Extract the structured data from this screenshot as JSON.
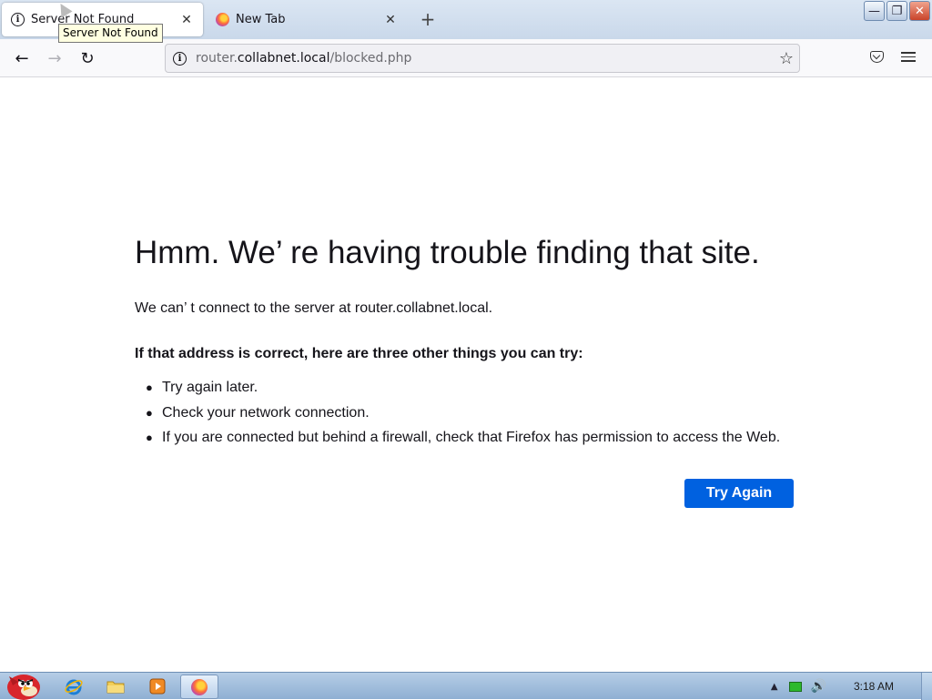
{
  "tabs": [
    {
      "label": "Server Not Found",
      "icon": "info-icon",
      "active": true
    },
    {
      "label": "New Tab",
      "icon": "firefox-icon",
      "active": false
    }
  ],
  "tooltip": "Server Not Found",
  "url": {
    "prefix": "router.",
    "host": "collabnet.local",
    "path": "/blocked.php"
  },
  "error": {
    "title": "Hmm. We’ re having trouble finding that site.",
    "description": "We can’ t connect to the server at router.collabnet.local.",
    "tips_heading": "If that address is correct, here are three other things you can try:",
    "tips": [
      "Try again later.",
      "Check your network connection.",
      "If you are connected but behind a firewall, check that Firefox has permission to access the Web."
    ],
    "button_label": "Try Again"
  },
  "taskbar": {
    "clock": "3:18 AM",
    "pinned": [
      "internet-explorer-icon",
      "folder-icon",
      "media-player-icon",
      "firefox-icon"
    ]
  },
  "colors": {
    "accent_button": "#0061e0",
    "text": "#15141a"
  }
}
